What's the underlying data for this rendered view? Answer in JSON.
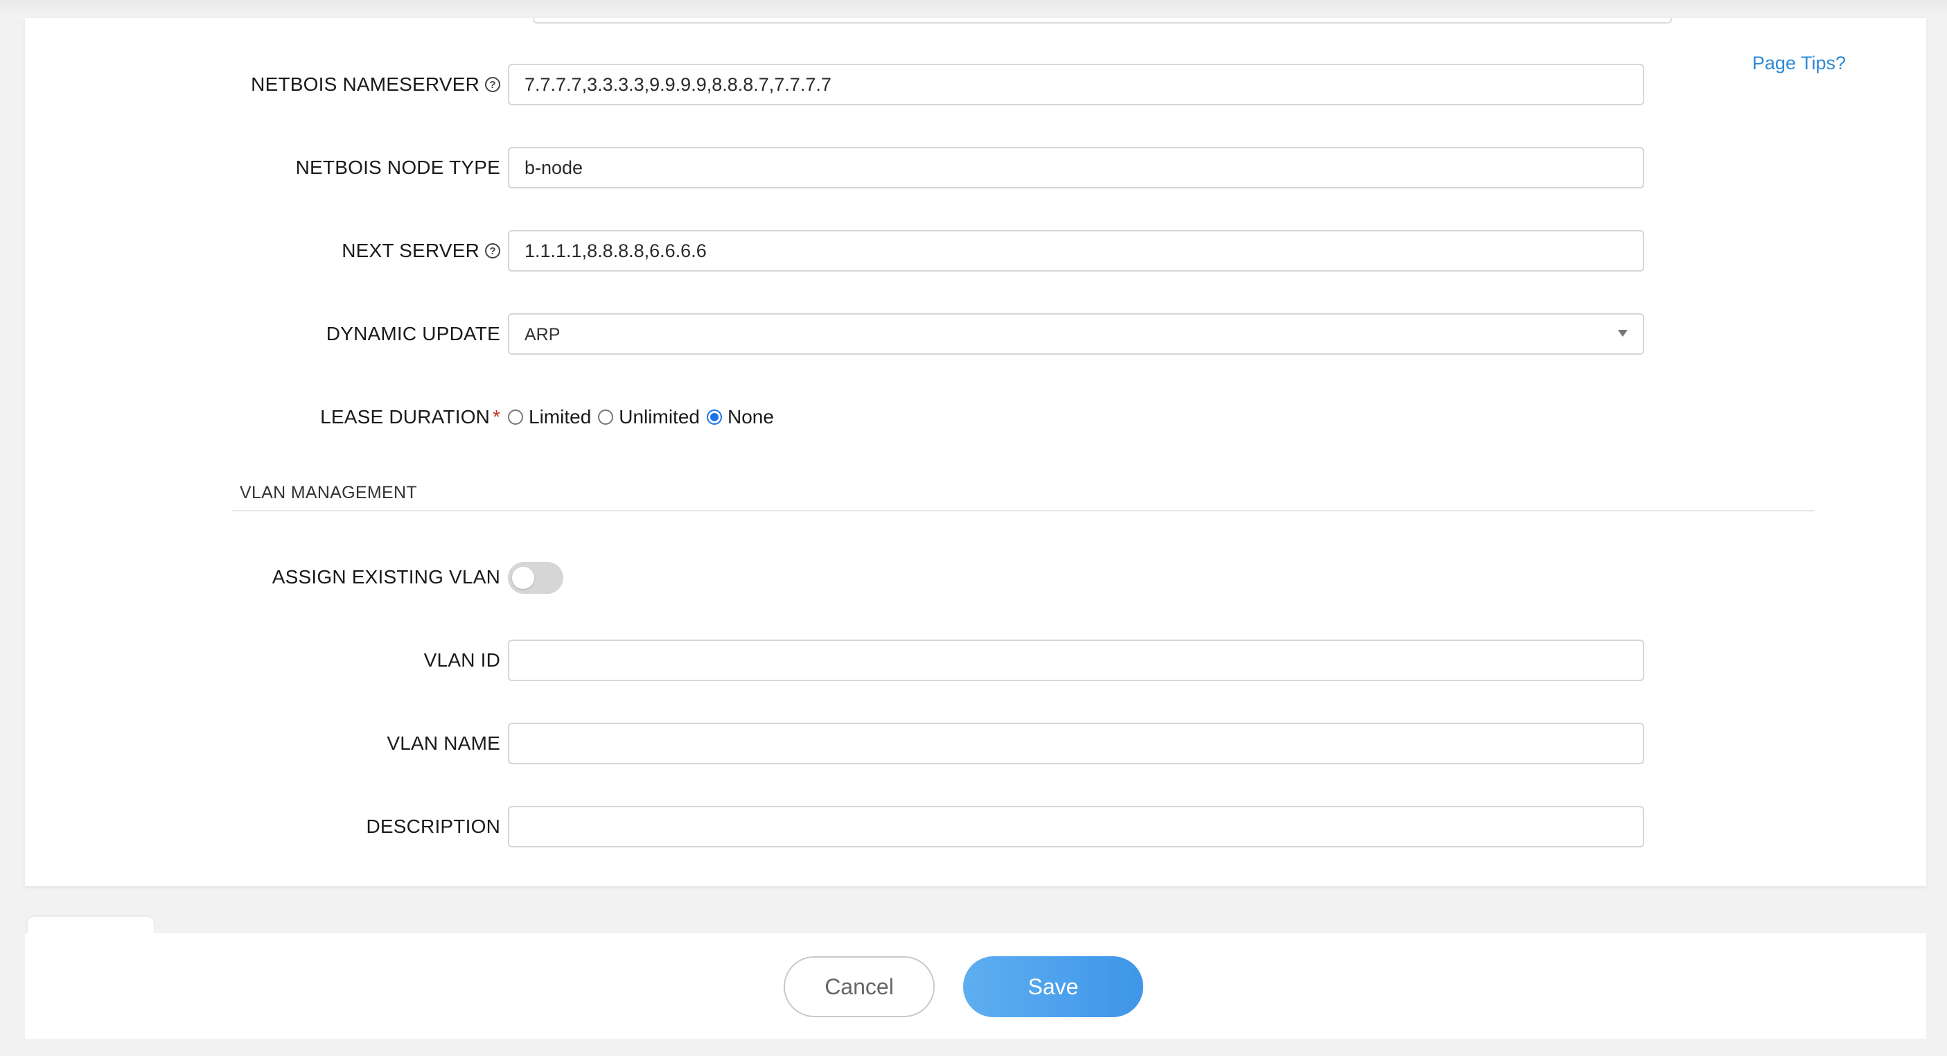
{
  "page_tips": "Page Tips?",
  "fields": {
    "netbios_nameserver": {
      "label": "NETBOIS NAMESERVER",
      "value": "7.7.7.7,3.3.3.3,9.9.9.9,8.8.8.7,7.7.7.7"
    },
    "netbios_node_type": {
      "label": "NETBOIS NODE TYPE",
      "value": "b-node"
    },
    "next_server": {
      "label": "NEXT SERVER",
      "value": "1.1.1.1,8.8.8.8,6.6.6.6"
    },
    "dynamic_update": {
      "label": "DYNAMIC UPDATE",
      "value": "ARP"
    },
    "lease_duration": {
      "label": "LEASE DURATION",
      "required_mark": "*",
      "options": [
        "Limited",
        "Unlimited",
        "None"
      ],
      "selected": "None"
    }
  },
  "vlan_section": {
    "title": "VLAN MANAGEMENT",
    "assign_existing_vlan": {
      "label": "ASSIGN EXISTING VLAN",
      "enabled": false
    },
    "vlan_id": {
      "label": "VLAN ID",
      "value": ""
    },
    "vlan_name": {
      "label": "VLAN NAME",
      "value": ""
    },
    "description": {
      "label": "DESCRIPTION",
      "value": ""
    }
  },
  "footer": {
    "cancel_label": "Cancel",
    "save_label": "Save"
  },
  "colors": {
    "accent": "#2d8ad6",
    "save_button": "#4a9fec",
    "radio_selected": "#1b73e8",
    "required": "#d0302a",
    "toggle_off": "#d6d6d6"
  }
}
